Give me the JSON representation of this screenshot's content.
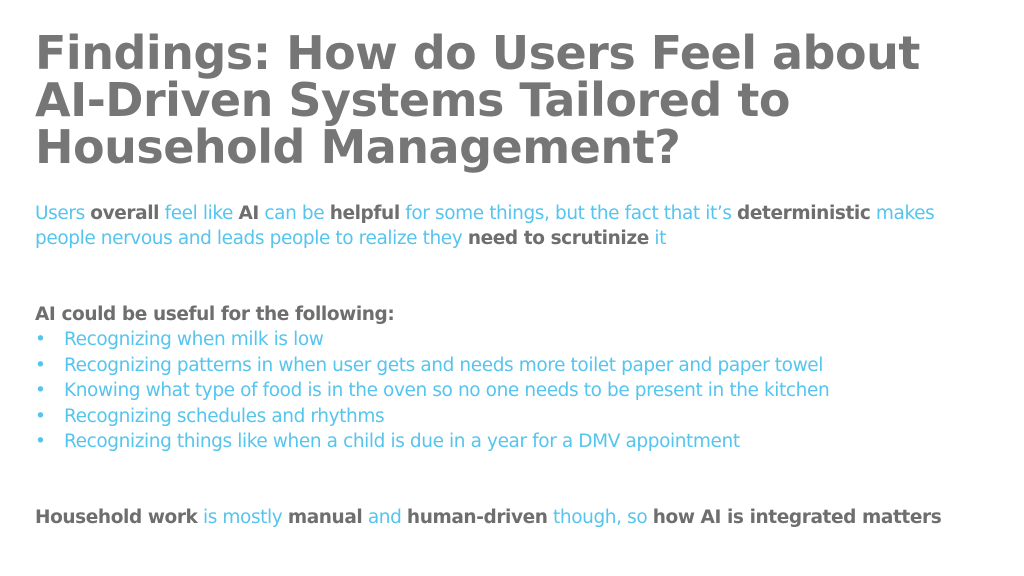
{
  "slide": {
    "title": "Findings: How do Users Feel about AI-Driven Systems Tailored to Household Management?",
    "intro": [
      {
        "t": "Users ",
        "b": false
      },
      {
        "t": "overall",
        "b": true
      },
      {
        "t": " feel like ",
        "b": false
      },
      {
        "t": "AI",
        "b": true
      },
      {
        "t": " can be ",
        "b": false
      },
      {
        "t": "helpful",
        "b": true
      },
      {
        "t": " for some things, but the fact that it’s ",
        "b": false
      },
      {
        "t": "deterministic",
        "b": true
      },
      {
        "t": " makes people nervous and leads people to realize they ",
        "b": false
      },
      {
        "t": "need to scrutinize",
        "b": true
      },
      {
        "t": " it",
        "b": false
      }
    ],
    "list_heading": "AI could be useful for the following:",
    "bullet_glyph": "•",
    "bullets": [
      "Recognizing when milk is low",
      "Recognizing patterns in when user gets and needs more toilet paper and paper towel",
      "Knowing what type of food is in the oven so no one needs to be present in the kitchen",
      "Recognizing schedules and rhythms",
      "Recognizing things like when a child is due in a year for a DMV appointment"
    ],
    "conclusion": [
      {
        "t": "Household work",
        "b": true
      },
      {
        "t": " is mostly ",
        "b": false
      },
      {
        "t": "manual",
        "b": true
      },
      {
        "t": " and ",
        "b": false
      },
      {
        "t": "human-driven",
        "b": true
      },
      {
        "t": " though, so ",
        "b": false
      },
      {
        "t": "how AI is integrated matters",
        "b": true
      }
    ]
  },
  "colors": {
    "title": "#767676",
    "accent_text": "#55c4ee",
    "emphasis_text": "#6e6e6e",
    "background": "#ffffff"
  }
}
